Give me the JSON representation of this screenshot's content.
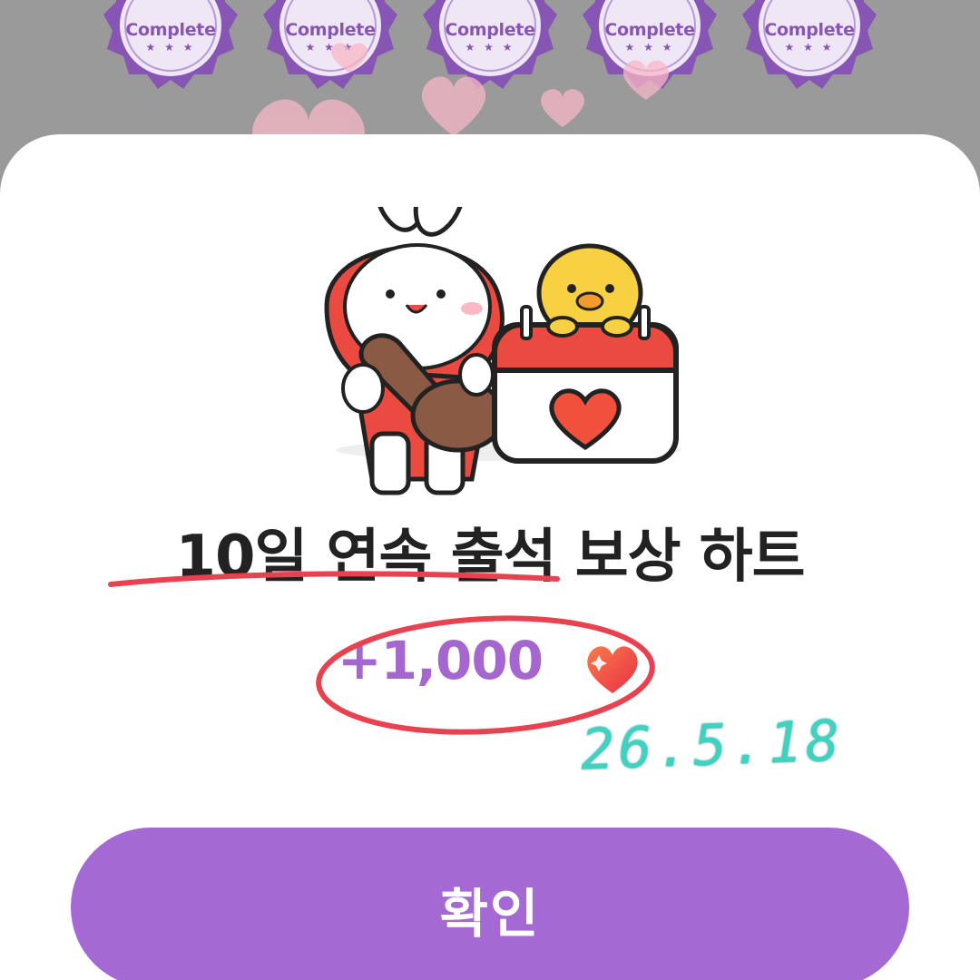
{
  "badges": [
    {
      "label": "Complete",
      "stars": "★ ★ ★"
    },
    {
      "label": "Complete",
      "stars": "★ ★ ★"
    },
    {
      "label": "Complete",
      "stars": "★ ★ ★"
    },
    {
      "label": "Complete",
      "stars": "★ ★ ★"
    },
    {
      "label": "Complete",
      "stars": "★ ★ ★"
    }
  ],
  "modal": {
    "title": "10일 연속 출석 보상 하트",
    "reward_amount": "+1,000",
    "reward_icon": "heart-icon",
    "confirm_label": "확인"
  },
  "annotation": {
    "date_note": "26.5.18",
    "underline_color": "#e8414f",
    "circle_color": "#e8414f",
    "date_color": "#3fd2c0"
  },
  "colors": {
    "accent": "#a569d3",
    "badge": "#8756b5",
    "heart": "#f0503c",
    "title": "#222222"
  }
}
